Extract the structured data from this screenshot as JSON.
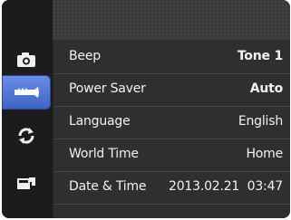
{
  "sidebar": {
    "items": [
      {
        "icon": "camera-icon",
        "active": false
      },
      {
        "icon": "setup-wrench-icon",
        "active": true
      },
      {
        "icon": "rotate-arrows-icon",
        "active": false
      },
      {
        "icon": "card-slot-icon",
        "active": false
      }
    ]
  },
  "menu": {
    "rows": [
      {
        "label": "Beep",
        "value": "Tone 1"
      },
      {
        "label": "Power Saver",
        "value": "Auto"
      },
      {
        "label": "Language",
        "value": "English"
      },
      {
        "label": "World Time",
        "value": "Home"
      },
      {
        "label": "Date & Time",
        "value": "2013.02.21  03:47"
      }
    ]
  },
  "colors": {
    "background": "#2f2f2f",
    "sidebar": "#1c1c1c",
    "active_tab": "#4f74d4",
    "text": "#f2f2f2"
  }
}
